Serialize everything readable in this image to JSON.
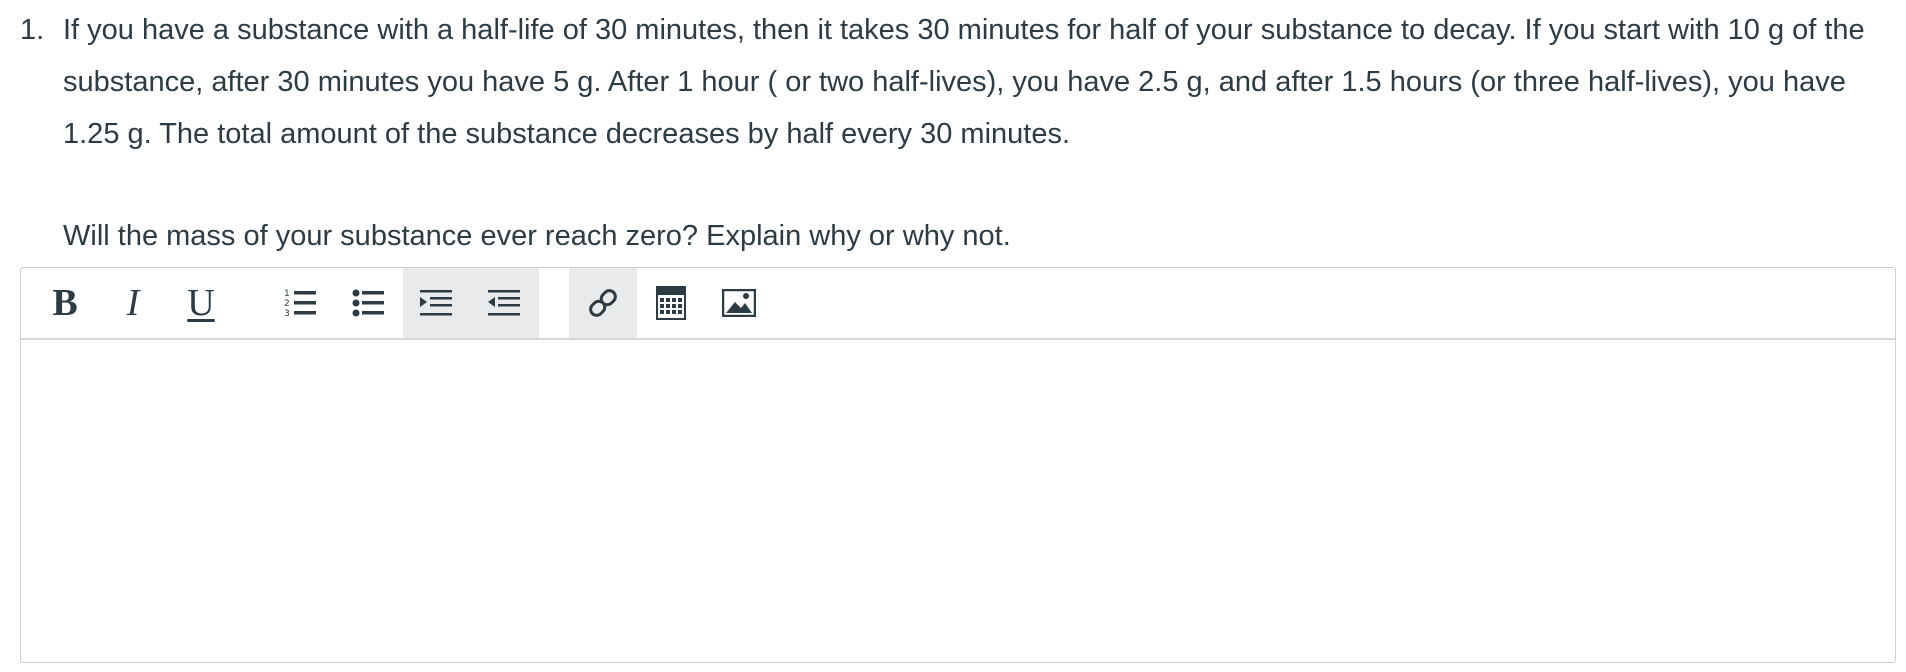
{
  "question": {
    "number": "1.",
    "text": "If you have a substance with a half-life of 30 minutes, then it takes 30 minutes for half of your substance to decay. If you start with 10 g of the substance, after 30 minutes you have 5 g. After 1 hour ( or two half-lives), you have 2.5 g, and after 1.5 hours (or three half-lives), you have 1.25 g. The total amount of the substance decreases by half every 30 minutes.",
    "prompt": "Will the mass of your substance ever reach zero? Explain why or why not."
  },
  "toolbar": {
    "bold_label": "B",
    "italic_label": "I",
    "underline_label": "U",
    "icons": [
      "numbered-list-icon",
      "bullet-list-icon",
      "indent-icon",
      "outdent-icon",
      "link-icon",
      "calculator-icon",
      "image-icon"
    ]
  },
  "editor": {
    "value": ""
  }
}
